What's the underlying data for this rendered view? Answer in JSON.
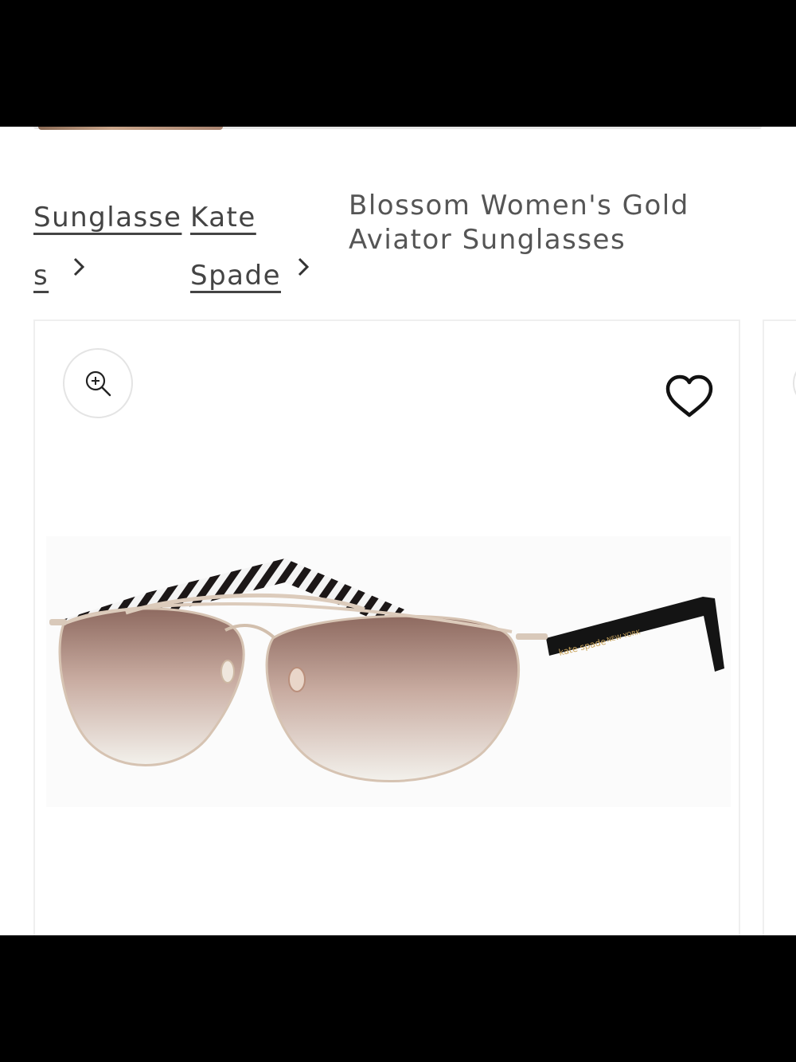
{
  "breadcrumb": {
    "items": [
      {
        "label_line1": "Sunglasse",
        "label_line2": "s"
      },
      {
        "label_line1": "Kate",
        "label_line2": "Spade"
      }
    ],
    "current_line1": "Blossom Women's Gold",
    "current_line2": "Aviator Sunglasses"
  },
  "product_image": {
    "temple_text_1": "kate spade",
    "temple_text_2": "NEW YORK"
  },
  "icons": {
    "zoom": "zoom-in-icon",
    "wishlist": "heart-icon",
    "breadcrumb_separator": "chevron-right-icon"
  },
  "colors": {
    "text": "#444444",
    "card_border": "#efefef",
    "lens_top": "#9b7468",
    "lens_bottom": "#f1efe9",
    "frame": "#d9c7b6",
    "temple": "#151515"
  }
}
